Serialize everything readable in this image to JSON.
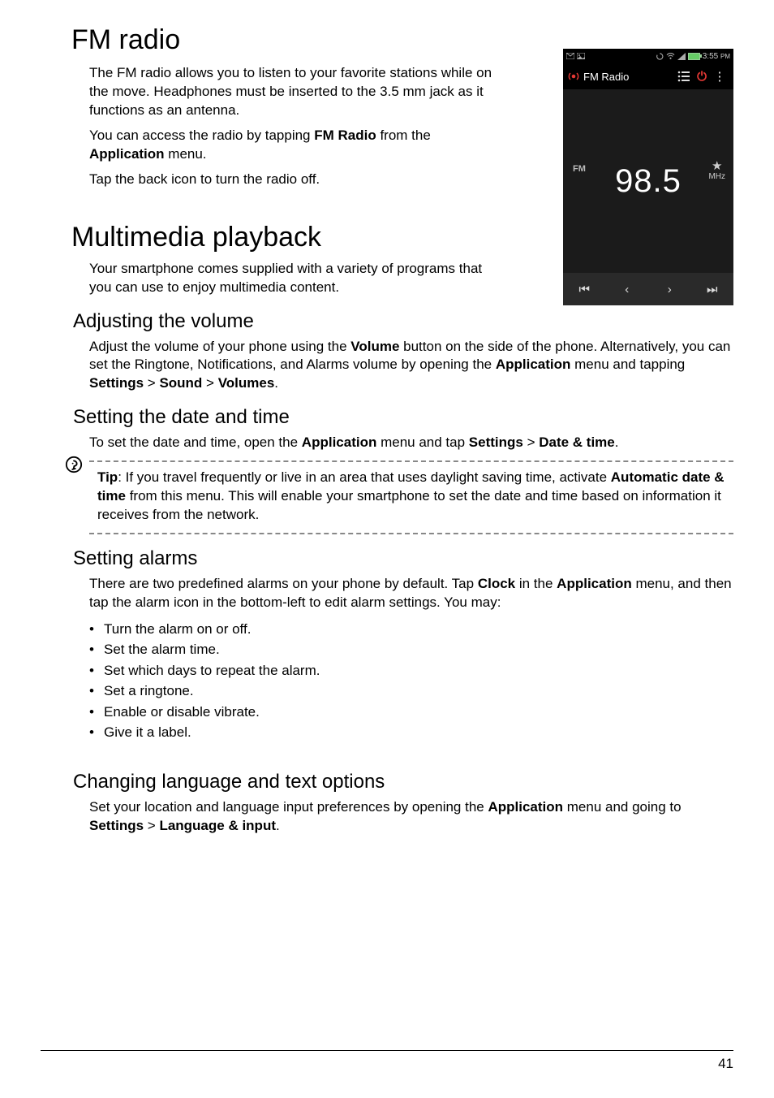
{
  "h1_fm": "FM radio",
  "fm_p1_pre": "The FM radio allows you to listen to your favorite stations while on the move. Headphones must be inserted to the 3.5 mm jack as it functions as an antenna.",
  "fm_p2_a": "You can access the radio by tapping ",
  "fm_p2_b": "FM Radio",
  "fm_p2_c": " from the ",
  "fm_p2_d": "Application",
  "fm_p2_e": " menu.",
  "fm_p3": "Tap the back icon to turn the radio off.",
  "h1_mm": "Multimedia playback",
  "mm_p1": "Your smartphone comes supplied with a variety of programs that you can use to enjoy multimedia content.",
  "h2_vol": "Adjusting the volume",
  "vol_a": "Adjust the volume of your phone using the ",
  "vol_b": "Volume",
  "vol_c": " button on the side of the phone. Alternatively, you can set the Ringtone, Notifications, and Alarms volume by opening the ",
  "vol_d": "Application",
  "vol_e": " menu and tapping ",
  "vol_f": "Settings",
  "vol_g": " > ",
  "vol_h": "Sound",
  "vol_i": " > ",
  "vol_j": "Volumes",
  "vol_k": ".",
  "h2_dt": "Setting the date and time",
  "dt_a": "To set the date and time, open the ",
  "dt_b": "Application",
  "dt_c": " menu and tap ",
  "dt_d": "Settings",
  "dt_e": " > ",
  "dt_f": "Date & time",
  "dt_g": ".",
  "tip_a": "Tip",
  "tip_b": ": If you travel frequently or live in an area that uses daylight saving time, activate ",
  "tip_c": "Automatic date & time",
  "tip_d": " from this menu. This will enable your smartphone to set the date and time based on information it receives from the network.",
  "h2_alarm": "Setting alarms",
  "al_a": "There are two predefined alarms on your phone by default. Tap ",
  "al_b": "Clock",
  "al_c": " in the ",
  "al_d": "Application",
  "al_e": " menu, and then tap the alarm icon in the bottom-left to edit alarm settings. You may:",
  "bullets": [
    "Turn the alarm on or off.",
    "Set the alarm time.",
    "Set which days to repeat the alarm.",
    "Set a ringtone.",
    "Enable or disable vibrate.",
    "Give it a label."
  ],
  "h2_lang": "Changing language and text options",
  "lang_a": "Set your location and language input preferences by opening the ",
  "lang_b": "Application",
  "lang_c": " menu and going to ",
  "lang_d": "Settings",
  "lang_e": " > ",
  "lang_f": "Language & input",
  "lang_g": ".",
  "page_number": "41",
  "phone": {
    "status_time": "3:55",
    "status_ampm": "PM",
    "app_title": "FM Radio",
    "band": "FM",
    "freq": "98.5",
    "unit": "MHz",
    "star": "★",
    "list_glyph": "≡",
    "power_glyph": "⏻",
    "menu_glyph": "⋮",
    "prev_track": "⏮",
    "prev": "‹",
    "next": "›",
    "next_track": "⏭"
  }
}
